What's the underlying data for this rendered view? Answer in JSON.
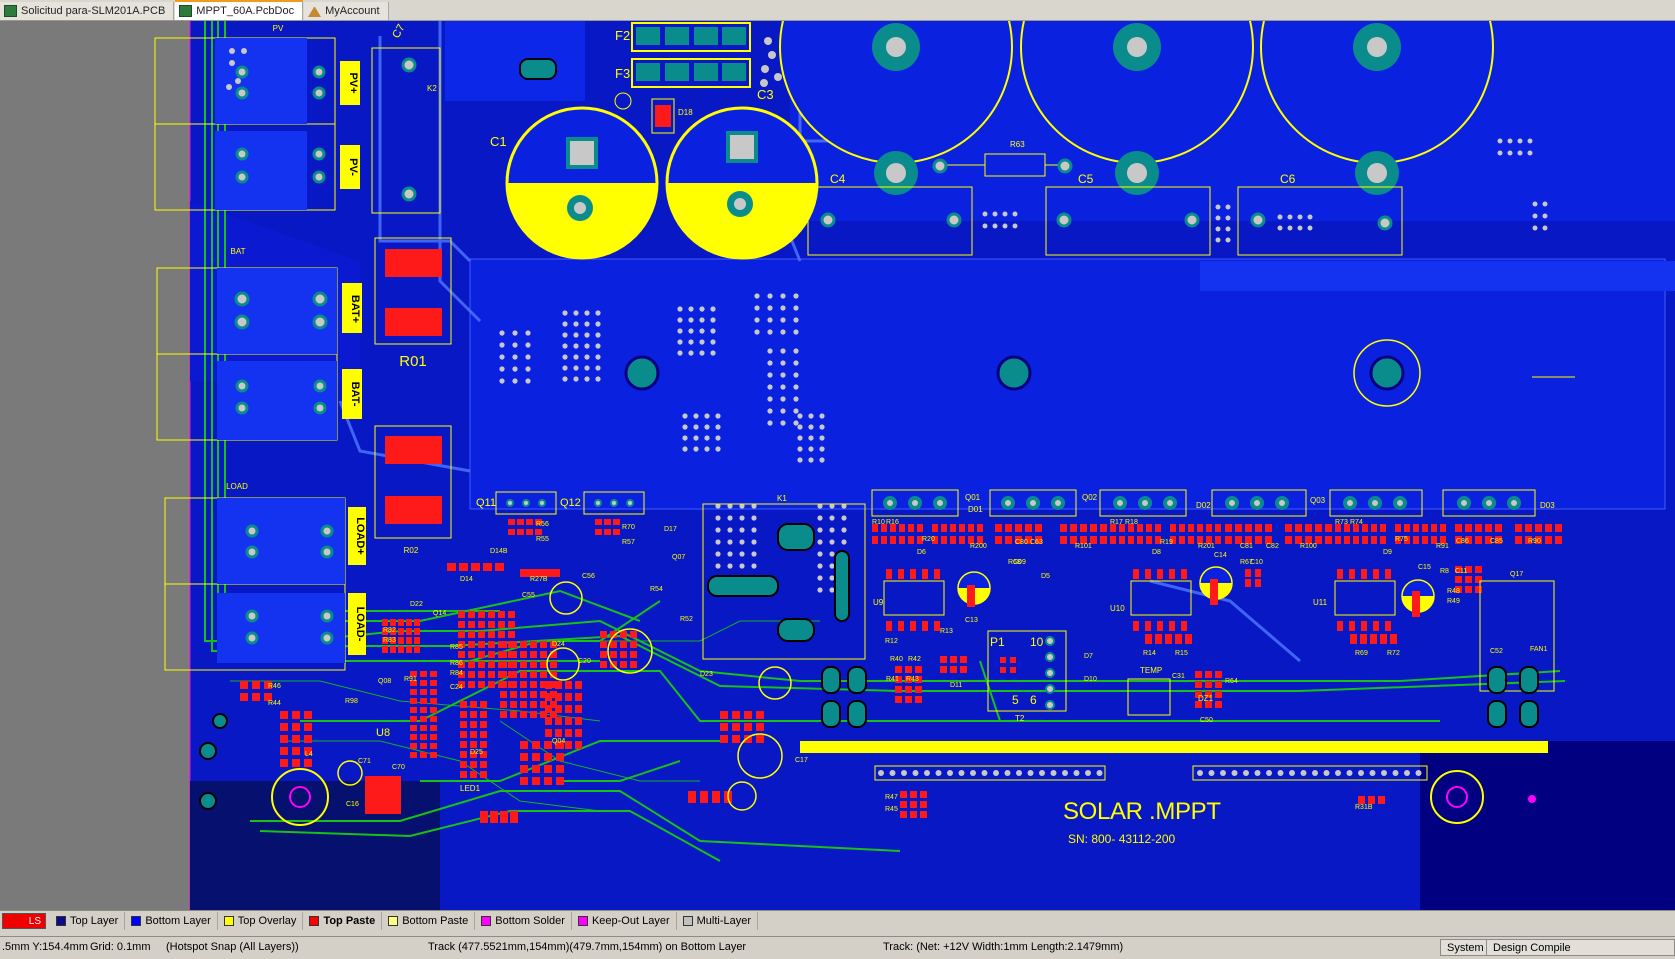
{
  "tabs": [
    {
      "label": "Solicitud para-SLM201A.PCB",
      "active": false,
      "icon": "pcb-icon"
    },
    {
      "label": "MPPT_60A.PcbDoc",
      "active": true,
      "icon": "pcb-icon"
    },
    {
      "label": "MyAccount",
      "active": false,
      "icon": "home-icon"
    }
  ],
  "board": {
    "connector_labels": [
      "PV+",
      "PV-",
      "BAT+",
      "BAT-",
      "LOAD+",
      "LOAD-"
    ],
    "connector_group_labels": [
      "PV",
      "BAT",
      "LOAD"
    ],
    "fuses": [
      "F2",
      "F3"
    ],
    "capacitors_large": [
      "C1",
      "C3"
    ],
    "capacitors_row": [
      "C4",
      "C5",
      "C6"
    ],
    "resistor_labels": [
      "R63",
      "R01",
      "R02",
      "K2",
      "C7",
      "K1",
      "D18"
    ],
    "mosfets": [
      "Q11",
      "Q12",
      "Q01",
      "D01",
      "Q02",
      "D02",
      "Q03",
      "D03"
    ],
    "ic_labels": [
      "U9",
      "U10",
      "U11",
      "U8",
      "T2",
      "TEMP",
      "FAN1",
      "DZ1",
      "LED1"
    ],
    "small_labels": [
      "R56",
      "R55",
      "R70",
      "R57",
      "D17",
      "Q07",
      "C55",
      "C56",
      "R54",
      "R52",
      "D14B",
      "D14",
      "R27B",
      "D24",
      "C20",
      "D22",
      "Q14",
      "R82",
      "R83",
      "R85",
      "R86",
      "R84",
      "C24",
      "R91",
      "Q08",
      "R46",
      "R44",
      "R98",
      "L4",
      "C70",
      "C71",
      "C16",
      "D25",
      "Q04",
      "D23",
      "C17",
      "D10",
      "D11",
      "D7",
      "D5",
      "C13",
      "C14",
      "C15",
      "R68",
      "C09",
      "R12",
      "R13",
      "R14",
      "R15",
      "R69",
      "R72",
      "R40",
      "R42",
      "R41",
      "R43",
      "R47",
      "R45",
      "R31B",
      "C50",
      "C31",
      "R64",
      "C52",
      "R48",
      "R49",
      "C11",
      "R8",
      "R67",
      "C10",
      "C80",
      "C63",
      "R101",
      "R200",
      "R201",
      "C81",
      "C82",
      "R100",
      "R75",
      "C86",
      "C85",
      "R90",
      "R91",
      "R17",
      "R18",
      "R19",
      "R20",
      "R10",
      "R16",
      "D6",
      "D8",
      "D9",
      "R73",
      "R74",
      "Q17",
      "P1",
      "10",
      "5",
      "6"
    ],
    "silk_title": "SOLAR .MPPT",
    "serial": "SN: 800- 43112-200",
    "colors": {
      "board_blue": "#0a1fd6",
      "pour_blue": "#1433f0",
      "overlay_yellow": "#ffff00",
      "paste_red": "#ff1a1a",
      "pad_teal": "#0a8c8c",
      "pad_gray": "#c8c8c8",
      "track_green": "#18c018",
      "keepout_magenta": "#ff00ff",
      "background_gray": "#7a7a7a"
    }
  },
  "layers": {
    "current": "LS",
    "items": [
      {
        "label": "Top Layer",
        "color": "#0c0c8a",
        "active": false
      },
      {
        "label": "Bottom Layer",
        "color": "#0000ff",
        "active": false
      },
      {
        "label": "Top Overlay",
        "color": "#ffff00",
        "active": false
      },
      {
        "label": "Top Paste",
        "color": "#ff0000",
        "active": true
      },
      {
        "label": "Bottom Paste",
        "color": "#ffff80",
        "active": false
      },
      {
        "label": "Bottom Solder",
        "color": "#ff00ff",
        "active": false
      },
      {
        "label": "Keep-Out Layer",
        "color": "#ff00ff",
        "active": false
      },
      {
        "label": "Multi-Layer",
        "color": "#c0c0c0",
        "active": false
      }
    ]
  },
  "status": {
    "coords": ".5mm Y:154.4mm",
    "grid": "Grid: 0.1mm",
    "snap": "(Hotspot Snap (All Layers))",
    "track": "Track (477.5521mm,154mm)(479.7mm,154mm) on Bottom Layer",
    "net": "Track: (Net: +12V Width:1mm Length:2.1479mm)",
    "system_button": "System",
    "compiler_button": "Design Compile"
  }
}
